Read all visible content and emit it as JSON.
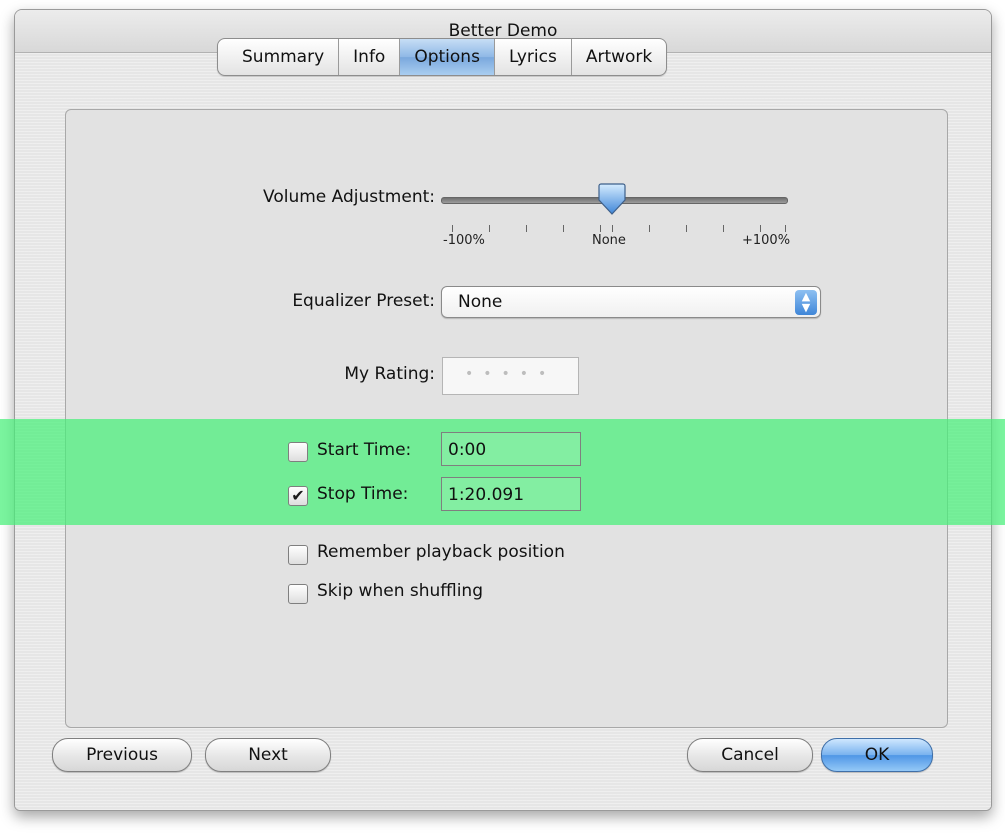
{
  "window": {
    "title": "Better Demo"
  },
  "tabs": [
    {
      "label": "Summary"
    },
    {
      "label": "Info"
    },
    {
      "label": "Options",
      "active": true
    },
    {
      "label": "Lyrics"
    },
    {
      "label": "Artwork"
    }
  ],
  "volume": {
    "label": "Volume Adjustment:",
    "min_label": "-100%",
    "mid_label": "None",
    "max_label": "+100%",
    "value_percent": 0
  },
  "equalizer": {
    "label": "Equalizer Preset:",
    "value": "None"
  },
  "rating": {
    "label": "My Rating:",
    "stars": 0,
    "max_stars": 5
  },
  "start_time": {
    "label": "Start Time:",
    "checked": false,
    "value": "0:00"
  },
  "stop_time": {
    "label": "Stop Time:",
    "checked": true,
    "value": "1:20.091"
  },
  "remember_playback": {
    "label": "Remember playback position",
    "checked": false
  },
  "skip_shuffling": {
    "label": "Skip when shuffling",
    "checked": false
  },
  "buttons": {
    "previous": "Previous",
    "next": "Next",
    "cancel": "Cancel",
    "ok": "OK"
  },
  "colors": {
    "highlight": "#46f078",
    "accent": "#4f96e6"
  }
}
